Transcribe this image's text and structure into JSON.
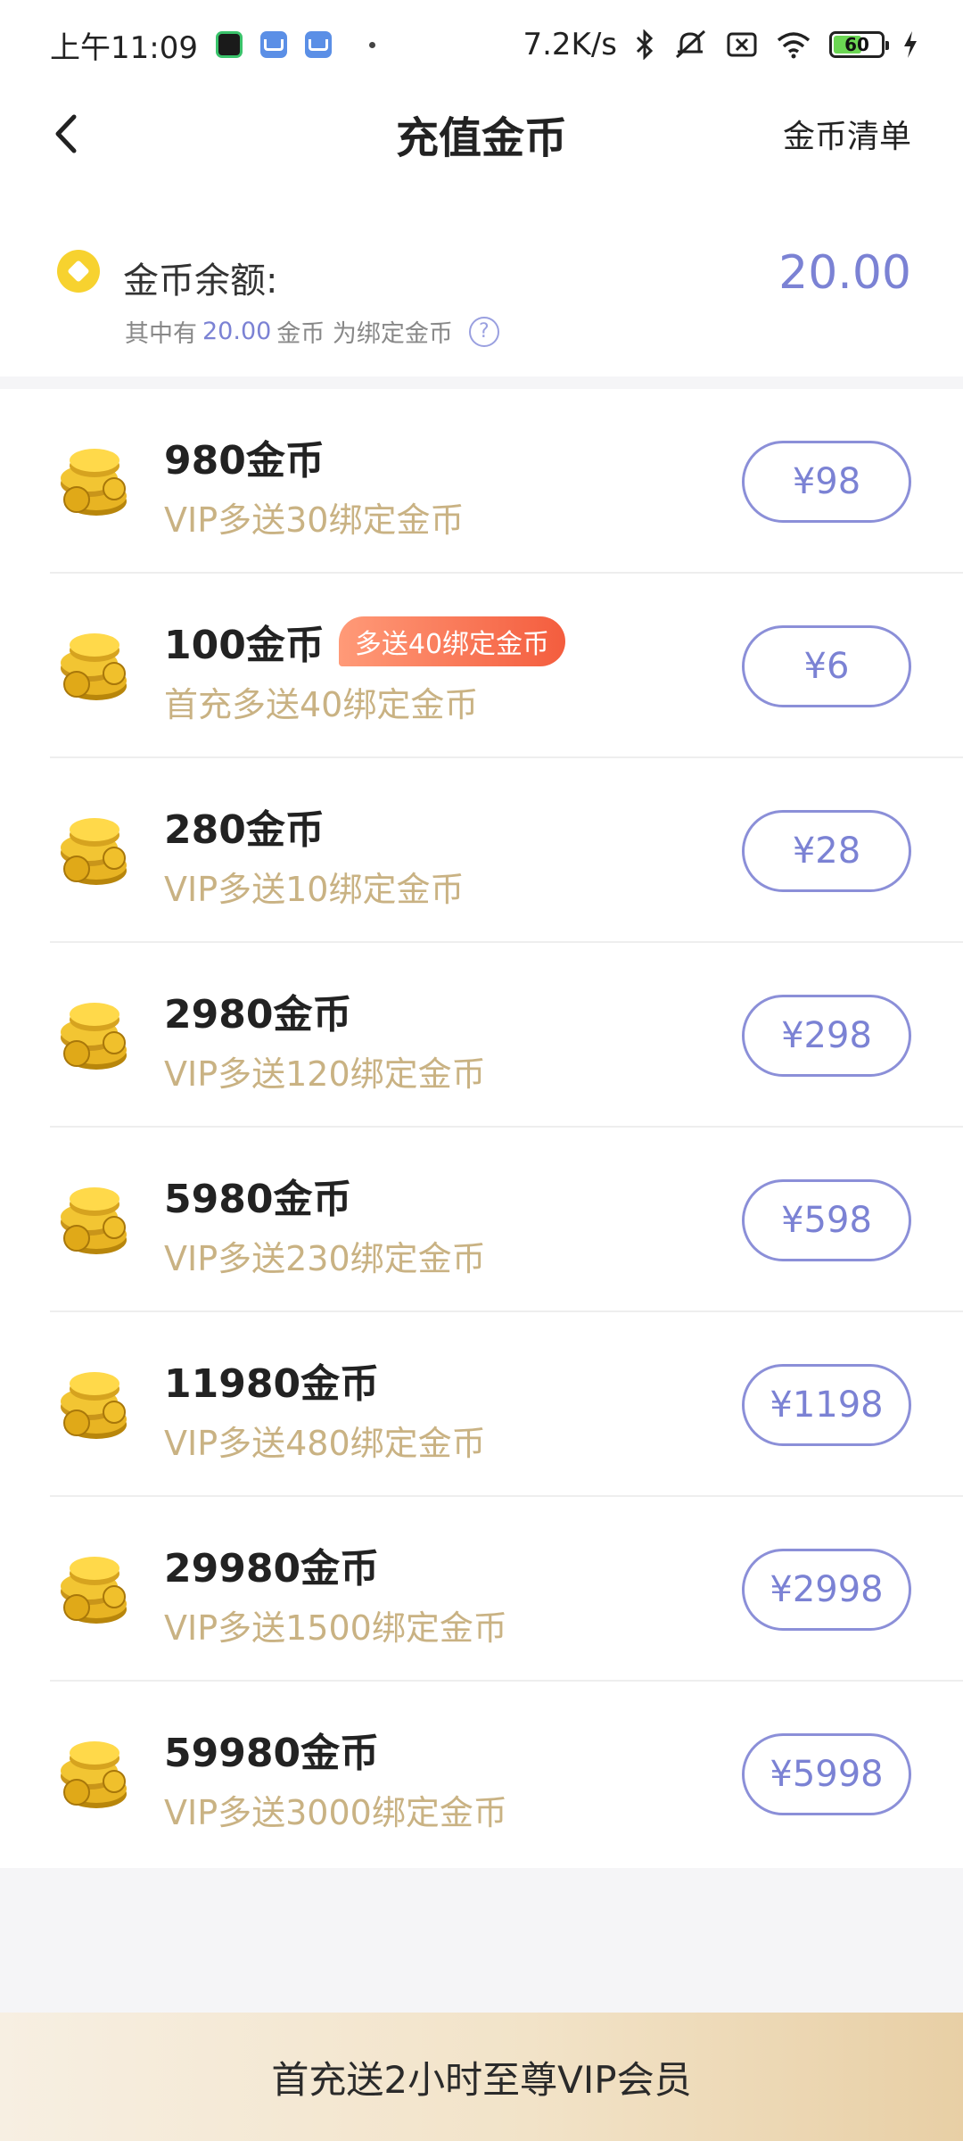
{
  "status_bar": {
    "time": "上午11:09",
    "net_speed": "7.2K/s",
    "battery": "60",
    "battery_level": 0.6
  },
  "nav": {
    "title": "充值金币",
    "right_link": "金币清单"
  },
  "balance": {
    "label": "金币余额:",
    "value": "20.00",
    "sub_prefix": "其中有",
    "sub_amount": "20.00",
    "sub_suffix": "金币 为绑定金币",
    "help_icon_text": "?"
  },
  "packages": [
    {
      "title": "980金币",
      "subtitle": "VIP多送30绑定金币",
      "price": "¥98"
    },
    {
      "title": "100金币",
      "subtitle": "首充多送40绑定金币",
      "price": "¥6",
      "badge": "多送40绑定金币"
    },
    {
      "title": "280金币",
      "subtitle": "VIP多送10绑定金币",
      "price": "¥28"
    },
    {
      "title": "2980金币",
      "subtitle": "VIP多送120绑定金币",
      "price": "¥298"
    },
    {
      "title": "5980金币",
      "subtitle": "VIP多送230绑定金币",
      "price": "¥598"
    },
    {
      "title": "11980金币",
      "subtitle": "VIP多送480绑定金币",
      "price": "¥1198"
    },
    {
      "title": "29980金币",
      "subtitle": "VIP多送1500绑定金币",
      "price": "¥2998"
    },
    {
      "title": "59980金币",
      "subtitle": "VIP多送3000绑定金币",
      "price": "¥5998"
    }
  ],
  "bottom_banner": {
    "text": "首充送2小时至尊VIP会员"
  },
  "colors": {
    "accent": "#7b82d4",
    "gold_text": "#c9b283",
    "promo": "#f45d3e"
  }
}
